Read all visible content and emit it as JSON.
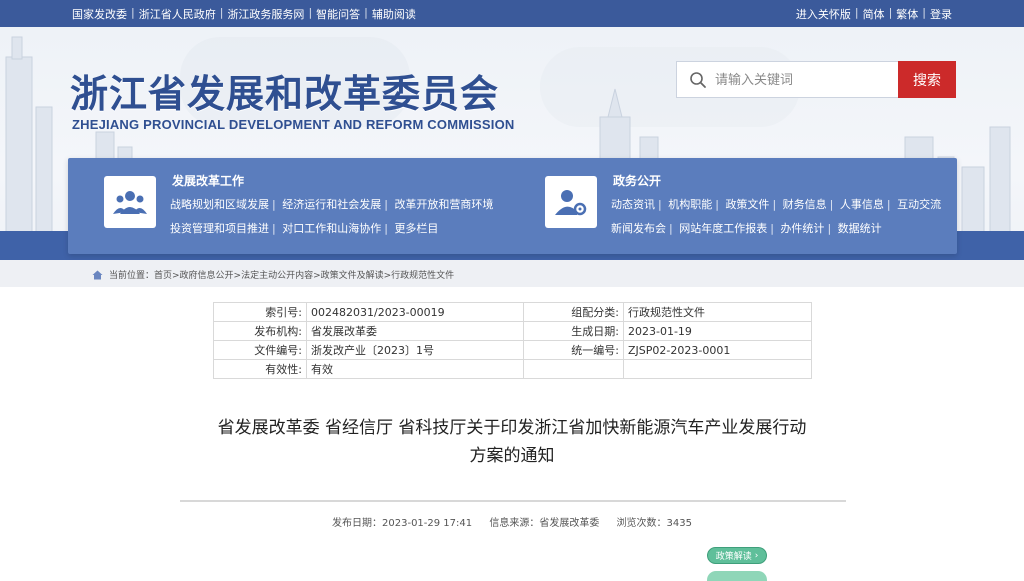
{
  "topbar": {
    "left_links": [
      "国家发改委",
      "浙江省人民政府",
      "浙江政务服务网",
      "智能问答",
      "辅助阅读"
    ],
    "right_links": [
      "进入关怀版",
      "简体",
      "繁体",
      "登录"
    ]
  },
  "header": {
    "title_cn": "浙江省发展和改革委员会",
    "title_en": "ZHEJIANG PROVINCIAL DEVELOPMENT AND REFORM COMMISSION"
  },
  "search": {
    "placeholder": "请输入关键词",
    "button_label": "搜索"
  },
  "nav": {
    "reform": {
      "title": "发展改革工作",
      "row1": [
        "战略规划和区域发展",
        "经济运行和社会发展",
        "改革开放和营商环境"
      ],
      "row2": [
        "投资管理和项目推进",
        "对口工作和山海协作",
        "更多栏目"
      ]
    },
    "affairs": {
      "title": "政务公开",
      "row1": [
        "动态资讯",
        "机构职能",
        "政策文件",
        "财务信息",
        "人事信息",
        "互动交流"
      ],
      "row2": [
        "新闻发布会",
        "网站年度工作报表",
        "办件统计",
        "数据统计"
      ]
    }
  },
  "breadcrumb": {
    "label": "当前位置：",
    "path": "首页>政府信息公开>法定主动公开内容>政策文件及解读>行政规范性文件"
  },
  "info_table": {
    "rows": [
      {
        "l1": "索引号:",
        "v1": "002482031/2023-00019",
        "l2": "组配分类:",
        "v2": "行政规范性文件"
      },
      {
        "l1": "发布机构:",
        "v1": "省发展改革委",
        "l2": "生成日期:",
        "v2": "2023-01-19"
      },
      {
        "l1": "文件编号:",
        "v1": "浙发改产业〔2023〕1号",
        "l2": "统一编号:",
        "v2": "ZJSP02-2023-0001"
      },
      {
        "l1": "有效性:",
        "v1": "有效",
        "l2": "",
        "v2": ""
      }
    ]
  },
  "article": {
    "title_line1": "省发展改革委 省经信厅 省科技厅关于印发浙江省加快新能源汽车产业发展行动",
    "title_line2": "方案的通知",
    "meta_date": "发布日期：2023-01-29 17:41",
    "meta_source": "信息来源：省发展改革委",
    "meta_views": "浏览次数：3435",
    "policy_button": "政策解读"
  },
  "colors": {
    "topbar": "#3b5a9b",
    "title": "#2f4f91",
    "nav_panel": "#5b7dbd",
    "search_button": "#cc2a2a",
    "policy_button": "#5fbf9a"
  }
}
